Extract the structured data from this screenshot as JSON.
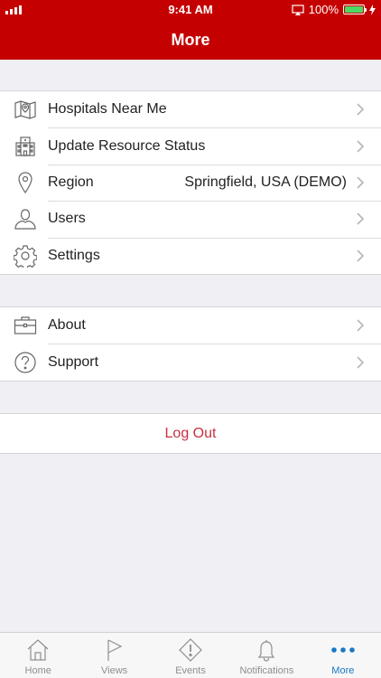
{
  "status_bar": {
    "time": "9:41 AM",
    "battery_percent": "100%",
    "battery_level": 1.0
  },
  "nav": {
    "title": "More"
  },
  "menu_primary": [
    {
      "label": "Hospitals Near Me",
      "icon": "map-icon"
    },
    {
      "label": "Update Resource Status",
      "icon": "building-icon"
    },
    {
      "label": "Region",
      "value": "Springfield, USA (DEMO)",
      "icon": "location-pin-icon"
    },
    {
      "label": "Users",
      "icon": "user-icon"
    },
    {
      "label": "Settings",
      "icon": "gear-icon"
    }
  ],
  "menu_secondary": [
    {
      "label": "About",
      "icon": "briefcase-icon"
    },
    {
      "label": "Support",
      "icon": "question-circle-icon"
    }
  ],
  "logout": {
    "label": "Log Out"
  },
  "tabs": [
    {
      "label": "Home",
      "icon": "home-icon"
    },
    {
      "label": "Views",
      "icon": "flag-icon"
    },
    {
      "label": "Events",
      "icon": "alert-diamond-icon"
    },
    {
      "label": "Notifications",
      "icon": "bell-icon"
    },
    {
      "label": "More",
      "icon": "more-dots-icon",
      "active": true
    }
  ],
  "colors": {
    "brand": "#c50000",
    "logout_text": "#c9303e",
    "tab_active": "#1779c6",
    "tab_inactive": "#8e8e93"
  }
}
